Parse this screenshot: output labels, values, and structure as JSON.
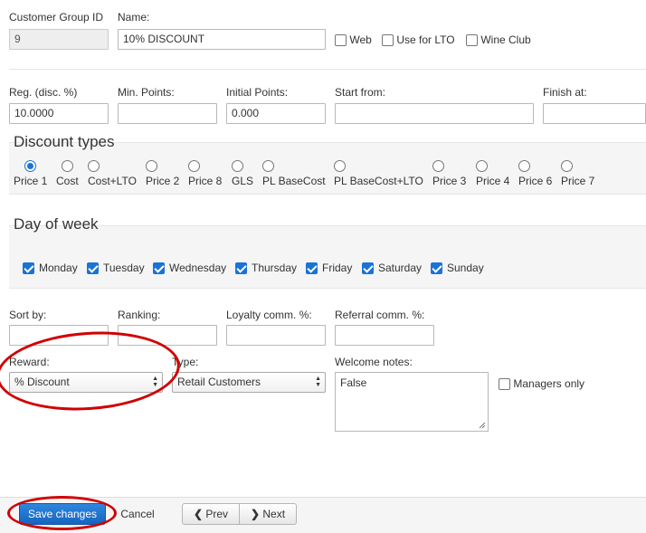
{
  "header": {
    "group_id_label": "Customer Group ID",
    "group_id_value": "9",
    "name_label": "Name:",
    "name_value": "10% DISCOUNT",
    "flags": [
      {
        "label": "Web",
        "checked": false
      },
      {
        "label": "Use for LTO",
        "checked": false
      },
      {
        "label": "Wine Club",
        "checked": false
      }
    ]
  },
  "row2": {
    "reg_label": "Reg. (disc. %)",
    "reg_value": "10.0000",
    "min_points_label": "Min. Points:",
    "min_points_value": "",
    "initial_points_label": "Initial Points:",
    "initial_points_value": "0.000",
    "start_label": "Start from:",
    "start_value": "",
    "finish_label": "Finish at:",
    "finish_value": ""
  },
  "discount_types": {
    "legend": "Discount types",
    "options": [
      {
        "label": "Price 1",
        "selected": true
      },
      {
        "label": "Cost",
        "selected": false
      },
      {
        "label": "Cost+LTO",
        "selected": false
      },
      {
        "label": "Price 2",
        "selected": false
      },
      {
        "label": "Price 8",
        "selected": false
      },
      {
        "label": "GLS",
        "selected": false
      },
      {
        "label": "PL BaseCost",
        "selected": false
      },
      {
        "label": "PL BaseCost+LTO",
        "selected": false
      },
      {
        "label": "Price 3",
        "selected": false
      },
      {
        "label": "Price 4",
        "selected": false
      },
      {
        "label": "Price 6",
        "selected": false
      },
      {
        "label": "Price 7",
        "selected": false
      }
    ]
  },
  "day_of_week": {
    "legend": "Day of week",
    "days": [
      {
        "label": "Monday",
        "checked": true
      },
      {
        "label": "Tuesday",
        "checked": true
      },
      {
        "label": "Wednesday",
        "checked": true
      },
      {
        "label": "Thursday",
        "checked": true
      },
      {
        "label": "Friday",
        "checked": true
      },
      {
        "label": "Saturday",
        "checked": true
      },
      {
        "label": "Sunday",
        "checked": true
      }
    ]
  },
  "row3": {
    "sort_label": "Sort by:",
    "sort_value": "",
    "ranking_label": "Ranking:",
    "ranking_value": "",
    "loyalty_label": "Loyalty comm. %:",
    "loyalty_value": "",
    "referral_label": "Referral comm. %:",
    "referral_value": ""
  },
  "row4": {
    "reward_label": "Reward:",
    "reward_value": "% Discount",
    "type_label": "Type:",
    "type_value": "Retail Customers",
    "welcome_label": "Welcome notes:",
    "welcome_value": "False",
    "managers_only_label": "Managers only",
    "managers_only_checked": false
  },
  "footer": {
    "save_label": "Save changes",
    "cancel_label": "Cancel",
    "prev_label": "Prev",
    "next_label": "Next"
  },
  "colors": {
    "accent": "#1a73d6",
    "annotation": "#d00000"
  }
}
